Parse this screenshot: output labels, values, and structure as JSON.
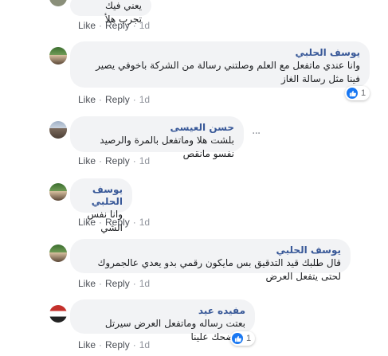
{
  "colors": {
    "bubble": "#f2f3f5",
    "author": "#385898",
    "action_link": "#4b4f56",
    "like_blue": "#1877f2"
  },
  "comments": [
    {
      "author": "",
      "text": "يعني فيك تجرب هلأ",
      "actions": {
        "like": "Like",
        "reply": "Reply",
        "time": "1d"
      }
    },
    {
      "author": "يوسف الحلبي",
      "text": "وانا عندي ماتفعل مع العلم وصلتني رسالة من الشركة باخوفي يصير فينا مثل رسالة الغاز",
      "actions": {
        "like": "Like",
        "reply": "Reply",
        "time": "1d"
      },
      "reaction_count": "1"
    },
    {
      "author": "حسن العيسى",
      "text": "بلشت هلا وماتفعل بالمرة والرصيد نفسو مانقص",
      "actions": {
        "like": "Like",
        "reply": "Reply",
        "time": "1d"
      }
    },
    {
      "author": "يوسف الحلبي",
      "text": "وانا نفس الشي",
      "actions": {
        "like": "Like",
        "reply": "Reply",
        "time": "1d"
      }
    },
    {
      "author": "يوسف الحلبي",
      "text": "قال طلبك قيد التدقيق بس مايكون رقمي بدو يعدي عالجمروك لحتى يتفعل العرض",
      "actions": {
        "like": "Like",
        "reply": "Reply",
        "time": "1d"
      }
    },
    {
      "author": "مفيده عيد",
      "text": "بعتت رساله وماتفعل العرض سيرتل عبتضحك علينا",
      "actions": {
        "like": "Like",
        "reply": "Reply",
        "time": "1d"
      },
      "reaction_count": "1"
    }
  ]
}
